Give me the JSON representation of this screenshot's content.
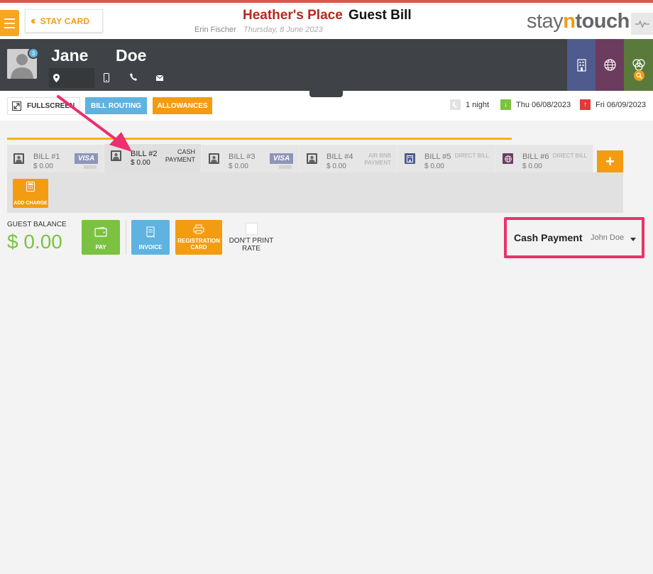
{
  "header": {
    "stay_card_label": "STAY CARD",
    "hotel_name": "Heather's Place",
    "page_title": "Guest Bill",
    "user_name": "Erin Fischer",
    "date": "Thursday, 8 June 2023",
    "logo": {
      "part1": "stay",
      "part2": "n",
      "part3": "touch"
    }
  },
  "guest": {
    "first_name": "Jane",
    "last_name": "Doe",
    "badge_count": "3"
  },
  "actions": {
    "fullscreen_label": "FULLSCREEN",
    "bill_routing_label": "BILL ROUTING",
    "allowances_label": "ALLOWANCES"
  },
  "stay": {
    "nights": "1 night",
    "arrival": "Thu 06/08/2023",
    "departure": "Fri 06/09/2023"
  },
  "bills": [
    {
      "name": "BILL #1",
      "amount": "$ 0.00",
      "payment": "VISA"
    },
    {
      "name": "BILL #2",
      "amount": "$ 0.00",
      "payment": "CASH PAYMENT"
    },
    {
      "name": "BILL #3",
      "amount": "$ 0.00",
      "payment": "VISA"
    },
    {
      "name": "BILL #4",
      "amount": "$ 0.00",
      "payment": "AIR BNB PAYMENT"
    },
    {
      "name": "BILL #5",
      "amount": "$ 0.00",
      "payment": "DIRECT BILL"
    },
    {
      "name": "BILL #6",
      "amount": "$ 0.00",
      "payment": "DIRECT BILL"
    }
  ],
  "add_bill_label": "+",
  "add_charge_label": "ADD CHARGE",
  "balance": {
    "label": "GUEST BALANCE",
    "amount": "$ 0.00"
  },
  "buttons": {
    "pay": "PAY",
    "invoice": "INVOICE",
    "registration_card": "REGISTRATION CARD",
    "dont_print_rate": "DON'T PRINT RATE"
  },
  "payment_selector": {
    "type": "Cash Payment",
    "guest": "John Doe"
  },
  "colors": {
    "accent_orange": "#f39c12",
    "accent_blue": "#5fb3e0",
    "green": "#7cc242",
    "highlight": "#e8336b",
    "hotel_red": "#b7281d"
  }
}
